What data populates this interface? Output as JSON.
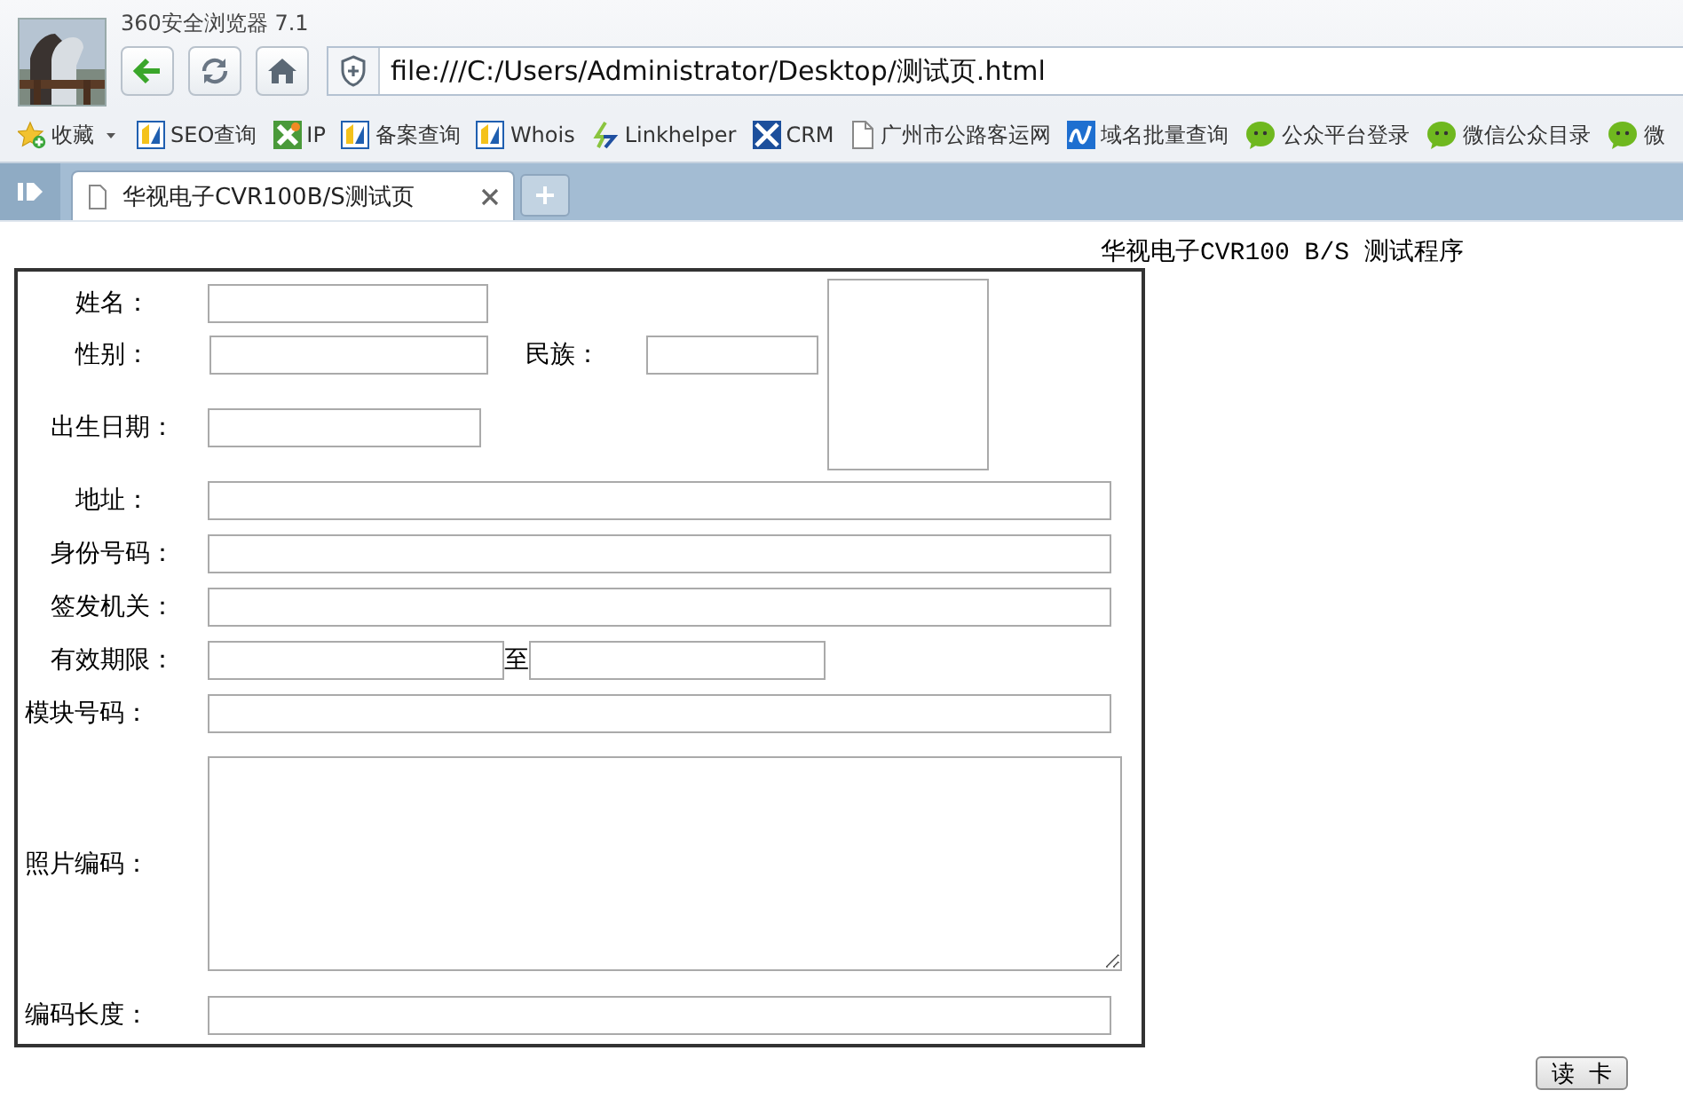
{
  "browser": {
    "title": "360安全浏览器 7.1",
    "address": "file:///C:/Users/Administrator/Desktop/测试页.html",
    "bookmarks": [
      {
        "label": "收藏",
        "kind": "favorites"
      },
      {
        "label": "SEO查询",
        "kind": "tile"
      },
      {
        "label": "IP",
        "kind": "tools"
      },
      {
        "label": "备案查询",
        "kind": "tile"
      },
      {
        "label": "Whois",
        "kind": "tile"
      },
      {
        "label": "Linkhelper",
        "kind": "link"
      },
      {
        "label": "CRM",
        "kind": "cross"
      },
      {
        "label": "广州市公路客运网",
        "kind": "page"
      },
      {
        "label": "域名批量查询",
        "kind": "wave"
      },
      {
        "label": "公众平台登录",
        "kind": "chat"
      },
      {
        "label": "微信公众目录",
        "kind": "chat"
      },
      {
        "label": "微",
        "kind": "chat"
      }
    ],
    "tabs": [
      {
        "label": "华视电子CVR100B/S测试页",
        "selected": true
      }
    ]
  },
  "page": {
    "heading": "华视电子CVR100 B/S 测试程序",
    "form": {
      "name_label": "姓名：",
      "gender_label": "性别：",
      "ethnicity_label": "民族：",
      "birth_label": "出生日期：",
      "rows": [
        {
          "label": "地址：",
          "kind": "text"
        },
        {
          "label": "身份号码：",
          "kind": "text"
        },
        {
          "label": "签发机关：",
          "kind": "text"
        },
        {
          "label": "有效期限：",
          "kind": "range",
          "separator": "至"
        },
        {
          "label": "模块号码：",
          "kind": "text"
        },
        {
          "label": "照片编码：",
          "kind": "area"
        },
        {
          "label": "编码长度：",
          "kind": "text"
        }
      ]
    },
    "read_button": "读  卡"
  }
}
